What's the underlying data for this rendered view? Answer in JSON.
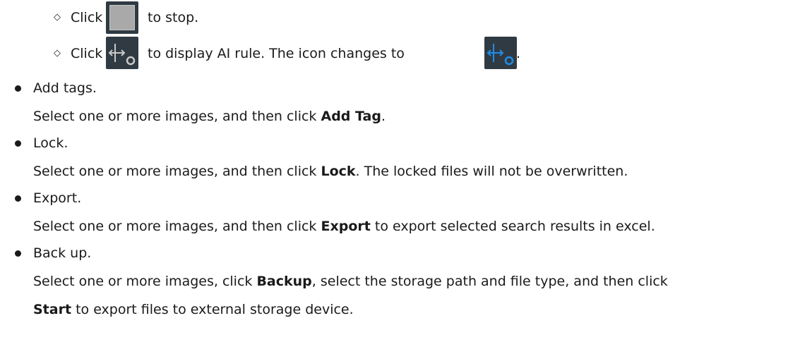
{
  "sub_items": [
    {
      "marker": "◇",
      "before": "Click",
      "after": "to stop.",
      "icon": "stop-icon"
    },
    {
      "marker": "◇",
      "before": "Click",
      "middle": "to display AI rule. The icon changes to",
      "after": ".",
      "icon": "ai-rule-icon",
      "icon_active": "ai-rule-active-icon"
    }
  ],
  "items": [
    {
      "title": "Add tags.",
      "desc_before": "Select one or more images, and then click ",
      "desc_bold": "Add Tag",
      "desc_after": "."
    },
    {
      "title": "Lock.",
      "desc_before": "Select one or more images, and then click ",
      "desc_bold": "Lock",
      "desc_after": ". The locked files will not be overwritten."
    },
    {
      "title": "Export.",
      "desc_before": "Select one or more images, and then click ",
      "desc_bold": "Export",
      "desc_after": " to export selected search results in excel."
    },
    {
      "title": "Back up.",
      "desc_before": "Select one or more images, click ",
      "desc_bold": "Backup",
      "desc_after": ", select the storage path and file type, and then click",
      "desc2_bold": "Start",
      "desc2_after": " to export files to external storage device."
    }
  ],
  "colors": {
    "text": "#1a1a1a",
    "icon_bg": "#303a42",
    "icon_inactive": "#c8c8c8",
    "icon_active": "#1e8ee8"
  }
}
